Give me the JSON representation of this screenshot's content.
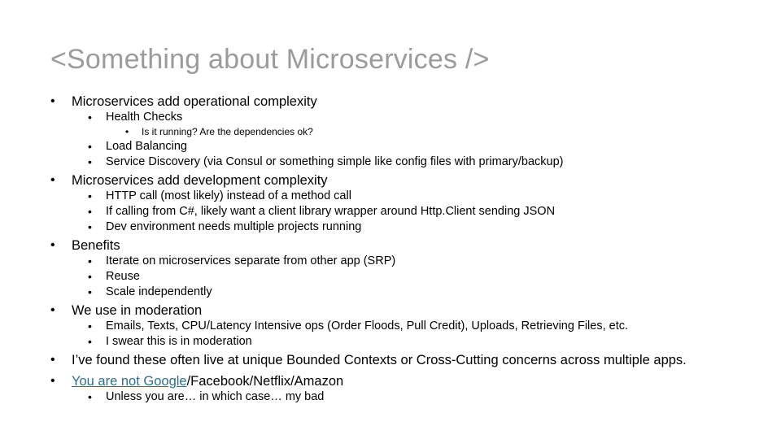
{
  "slide": {
    "title": "<Something about Microservices />",
    "bullet_glyph": "•",
    "link_color": "#2d6f8e",
    "title_color": "#9b9b9b",
    "sections": [
      {
        "level1": "Microservices add operational complexity",
        "level2": [
          {
            "text": "Health Checks",
            "level3": [
              "Is it running?  Are the dependencies ok?"
            ]
          },
          {
            "text": "Load Balancing",
            "level3": []
          },
          {
            "text": "Service Discovery (via Consul or something simple like config files with primary/backup)",
            "level3": []
          }
        ]
      },
      {
        "level1": "Microservices add development complexity",
        "level2": [
          {
            "text": "HTTP call (most likely) instead of a method call",
            "level3": []
          },
          {
            "text": "If calling from C#, likely want a client library wrapper around Http.Client sending JSON",
            "level3": []
          },
          {
            "text": "Dev environment needs multiple projects running",
            "level3": []
          }
        ]
      },
      {
        "level1": "Benefits",
        "level2": [
          {
            "text": "Iterate on microservices separate from other app (SRP)",
            "level3": []
          },
          {
            "text": "Reuse",
            "level3": []
          },
          {
            "text": "Scale independently",
            "level3": []
          }
        ]
      },
      {
        "level1": "We use in moderation",
        "level2": [
          {
            "text": "Emails, Texts, CPU/Latency Intensive ops (Order Floods, Pull Credit), Uploads, Retrieving Files, etc.",
            "level3": []
          },
          {
            "text": "I swear this is in moderation",
            "level3": []
          }
        ]
      },
      {
        "level1": "I’ve found these often live at unique Bounded Contexts or Cross-Cutting concerns across multiple apps.",
        "level2": []
      },
      {
        "level1_link": "You are not Google",
        "level1_rest": "/Facebook/Netflix/Amazon",
        "level2": [
          {
            "text": "Unless you are… in which case… my bad",
            "level3": []
          }
        ]
      }
    ]
  }
}
